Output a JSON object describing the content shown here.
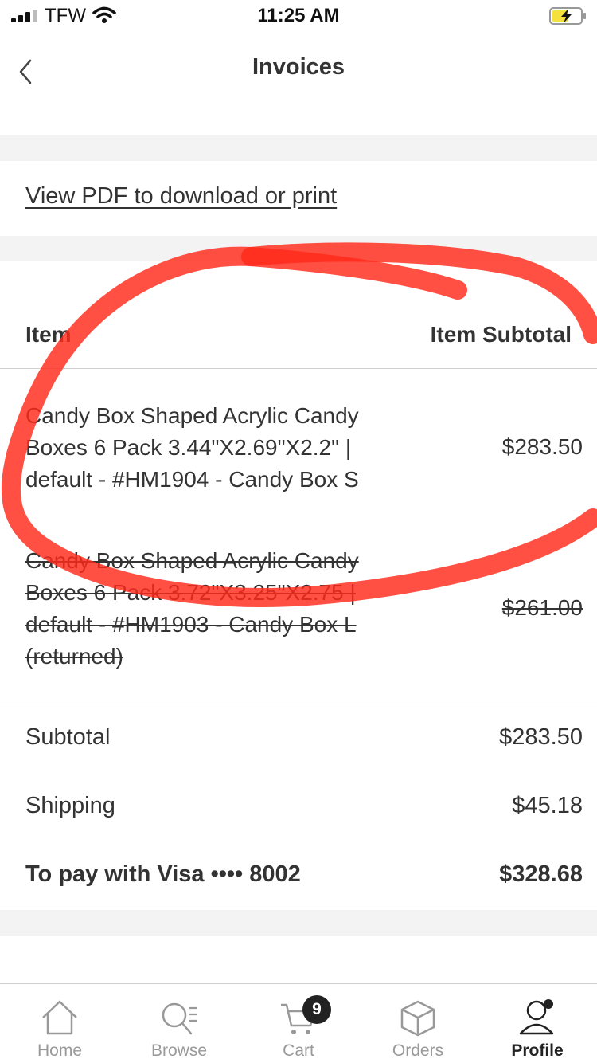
{
  "status_bar": {
    "carrier": "TFW",
    "time": "11:25 AM",
    "battery_color": "#f5e03c"
  },
  "header": {
    "title": "Invoices",
    "back_icon": "chevron-left-icon"
  },
  "pdf_link": "View PDF to download or print",
  "table": {
    "col_item": "Item",
    "col_subtotal": "Item Subtotal",
    "rows": [
      {
        "name": "Candy Box Shaped Acrylic Candy Boxes 6 Pack 3.44\"X2.69\"X2.2\" | default - #HM1904 - Candy Box S",
        "price": "$283.50",
        "returned": false
      },
      {
        "name": "Candy Box Shaped Acrylic Candy Boxes 6 Pack 3.72\"X3.25\"X2.75 | default - #HM1903 - Candy Box L (returned)",
        "price": "$261.00",
        "returned": true
      }
    ]
  },
  "summary": {
    "subtotal_label": "Subtotal",
    "subtotal_value": "$283.50",
    "shipping_label": "Shipping",
    "shipping_value": "$45.18",
    "pay_label": "To pay with Visa •••• 8002",
    "pay_value": "$328.68"
  },
  "tabs": [
    {
      "label": "Home",
      "icon": "home-icon",
      "active": false
    },
    {
      "label": "Browse",
      "icon": "browse-icon",
      "active": false
    },
    {
      "label": "Cart",
      "icon": "cart-icon",
      "active": false,
      "badge": "9"
    },
    {
      "label": "Orders",
      "icon": "box-icon",
      "active": false
    },
    {
      "label": "Profile",
      "icon": "profile-icon",
      "active": true
    }
  ],
  "annotation_color": "#ff2a1a"
}
